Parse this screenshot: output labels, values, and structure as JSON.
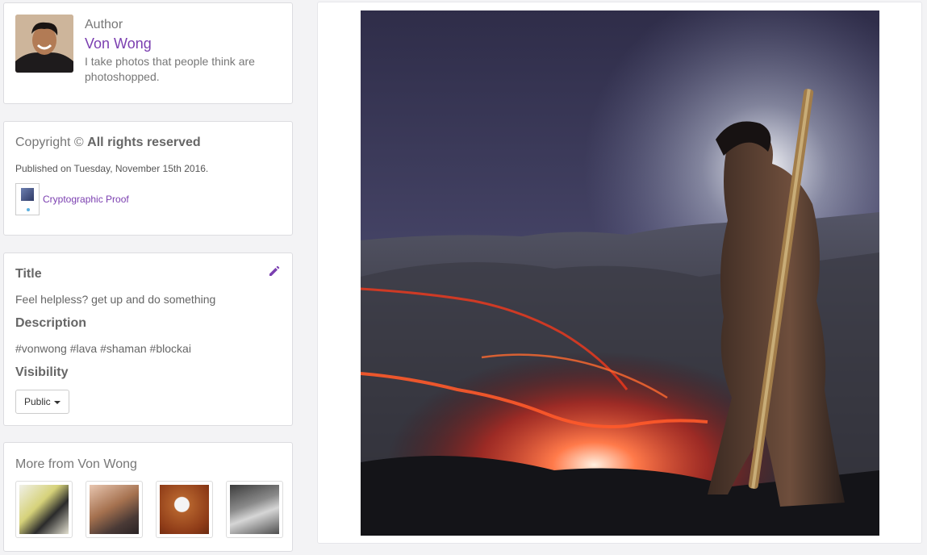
{
  "author": {
    "label": "Author",
    "name": "Von Wong",
    "bio": "I take photos that people think are photoshopped."
  },
  "copyright": {
    "prefix": "Copyright ©",
    "rights": "All rights reserved",
    "published": "Published on Tuesday, November 15th 2016.",
    "proof_link": "Cryptographic Proof"
  },
  "meta": {
    "title_heading": "Title",
    "title_value": "Feel helpless? get up and do something",
    "description_heading": "Description",
    "description_value": "#vonwong #lava #shaman #blockai",
    "visibility_heading": "Visibility",
    "visibility_value": "Public"
  },
  "more": {
    "title": "More from Von Wong",
    "thumbnails": [
      "polaroid-camera",
      "portrait-selfie",
      "headphones-on-orange",
      "laptop-desk"
    ]
  },
  "colors": {
    "accent": "#7b3fb0",
    "background": "#f3f3f5"
  },
  "icons": {
    "edit": "pencil-icon"
  }
}
